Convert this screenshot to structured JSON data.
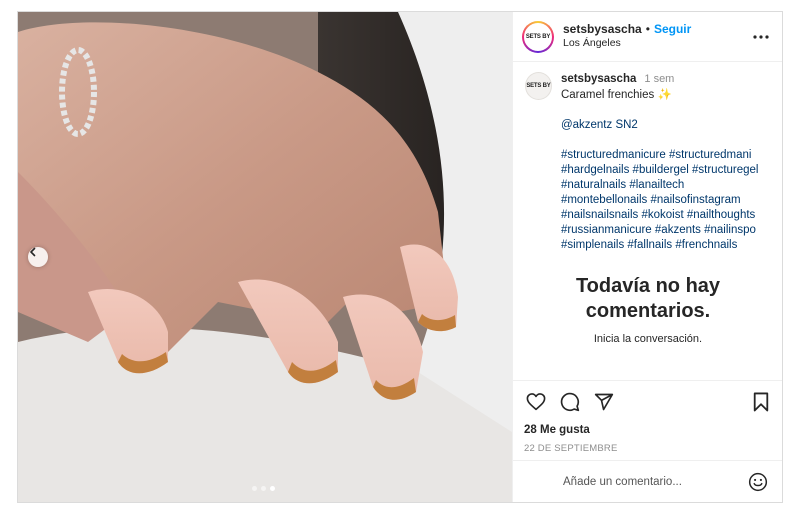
{
  "post": {
    "username": "setsbysascha",
    "separator": "•",
    "follow_label": "Seguir",
    "location": "Los Ángeles",
    "avatar_text": "SETS BY",
    "media": {
      "slide_count": 3,
      "active_slide": 3
    }
  },
  "caption": {
    "username": "setsbysascha",
    "time": "1 sem",
    "text": "Caramel frenchies ✨",
    "mention": "@akzentz SN2",
    "hashtags": "#structuredmanicure #structuredmani #hardgelnails #buildergel #structuregel #naturalnails #lanailtech #montebellonails #nailsofinstagram #nailsnailsnails #kokoist #nailthoughts #russianmanicure #akzents #nailinspo #simplenails #fallnails #frenchnails"
  },
  "comments": {
    "empty_title": "Todavía no hay comentarios.",
    "empty_subtitle": "Inicia la conversación."
  },
  "actions": {
    "icons": [
      "heart-icon",
      "comment-icon",
      "share-icon",
      "bookmark-icon"
    ],
    "likes": "28 Me gusta",
    "date": "22 DE SEPTIEMBRE"
  },
  "comment_box": {
    "placeholder": "Añade un comentario..."
  },
  "colors": {
    "accent": "#0095f6",
    "link": "#00376b",
    "muted": "#8e8e8e",
    "border": "#dbdbdb"
  }
}
